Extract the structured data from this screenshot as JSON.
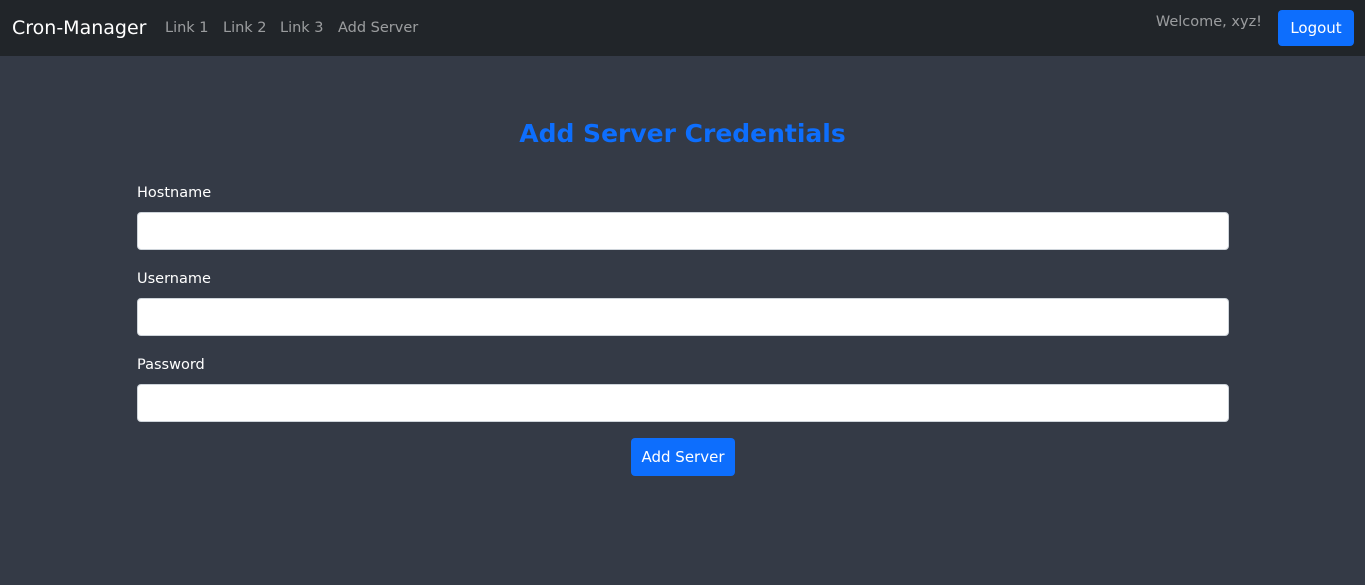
{
  "navbar": {
    "brand": "Cron-Manager",
    "links": [
      "Link 1",
      "Link 2",
      "Link 3",
      "Add Server"
    ],
    "welcome": "Welcome, xyz!",
    "logout_label": "Logout"
  },
  "form": {
    "title": "Add Server Credentials",
    "hostname_label": "Hostname",
    "hostname_value": "",
    "username_label": "Username",
    "username_value": "",
    "password_label": "Password",
    "password_value": "",
    "submit_label": "Add Server"
  },
  "colors": {
    "navbar_bg": "#212529",
    "page_bg": "#343a46",
    "accent": "#0d6efd"
  }
}
